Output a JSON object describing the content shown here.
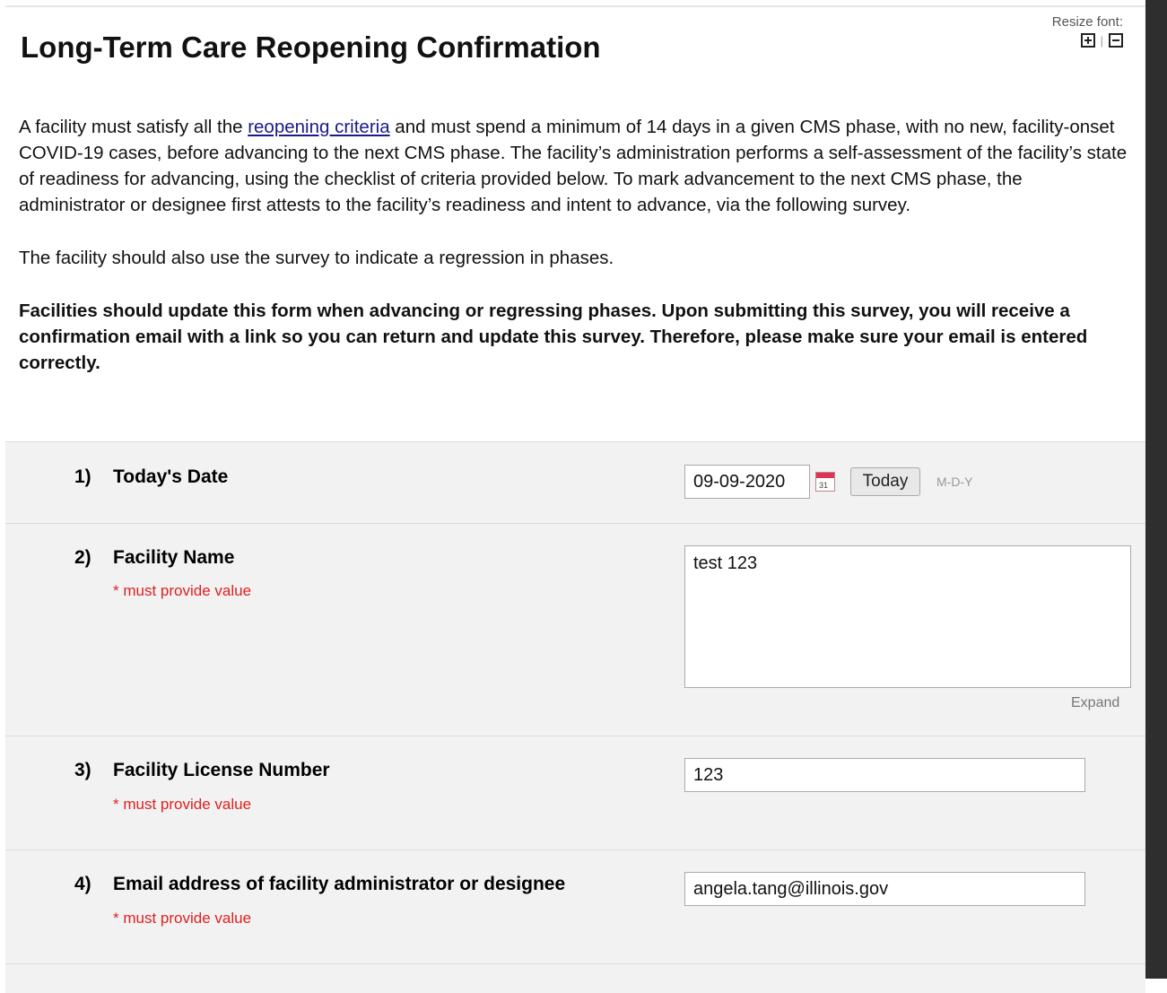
{
  "page": {
    "title": "Long-Term Care Reopening Confirmation",
    "resize_font_label": "Resize font:",
    "resize_separator": "|"
  },
  "intro": {
    "p1_before_link": "A facility must satisfy all the ",
    "p1_link": "reopening criteria",
    "p1_after_link": " and must spend a minimum of 14 days in a given CMS phase, with no new, facility-onset COVID-19 cases, before advancing to the next CMS phase. The facility’s administration performs a self-assessment of the facility’s state of readiness for advancing, using the checklist of criteria provided below. To mark advancement to the next CMS phase, the administrator or designee first attests to the facility’s readiness and intent to advance, via the following survey.",
    "p2": "The facility should also use the survey to indicate a regression in phases.",
    "p3": "Facilities should update this form when advancing or regressing phases. Upon submitting this survey, you will receive a confirmation email with a link so you can return and update this survey. Therefore, please make sure your email is entered correctly."
  },
  "questions": [
    {
      "num": "1)",
      "label": "Today's Date",
      "value": "09-09-2020",
      "today_label": "Today",
      "format": "M-D-Y",
      "calendar_day": "31"
    },
    {
      "num": "2)",
      "label": "Facility Name",
      "required": "* must provide value",
      "value": "test 123",
      "expand_label": "Expand"
    },
    {
      "num": "3)",
      "label": "Facility License Number",
      "required": "* must provide value",
      "value": "123"
    },
    {
      "num": "4)",
      "label": "Email address of facility administrator or designee",
      "required": "* must provide value",
      "value": "angela.tang@illinois.gov"
    }
  ]
}
